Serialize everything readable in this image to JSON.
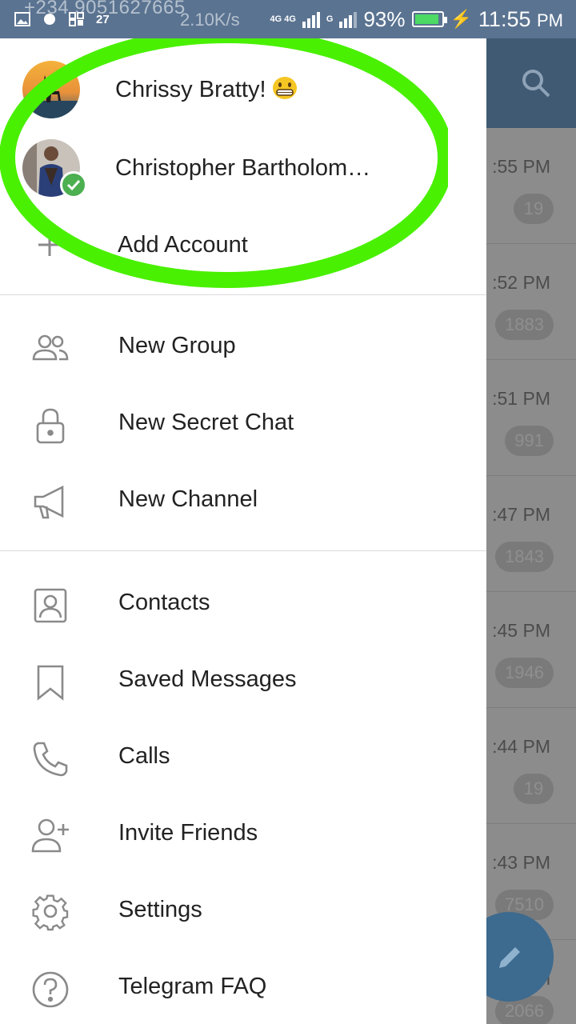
{
  "status_bar": {
    "overlay_number": "+234 9051627665",
    "badge": "27",
    "speed": "2.10K/s",
    "network_a": "4G 4G",
    "network_b": "G",
    "battery_percent": "93%",
    "time": "11:55",
    "ampm": "PM"
  },
  "accounts": [
    {
      "name": "Chrissy Bratty!",
      "emoji_icon": "grinning-face-emoji"
    },
    {
      "name": "Christopher Bartholom…",
      "verified": true
    }
  ],
  "add_account_label": "Add Account",
  "menu_group_1": [
    {
      "label": "New Group",
      "icon": "group-icon"
    },
    {
      "label": "New Secret Chat",
      "icon": "lock-icon"
    },
    {
      "label": "New Channel",
      "icon": "megaphone-icon"
    }
  ],
  "menu_group_2": [
    {
      "label": "Contacts",
      "icon": "contact-icon"
    },
    {
      "label": "Saved Messages",
      "icon": "bookmark-icon"
    },
    {
      "label": "Calls",
      "icon": "phone-icon"
    },
    {
      "label": "Invite Friends",
      "icon": "add-person-icon"
    },
    {
      "label": "Settings",
      "icon": "gear-icon"
    },
    {
      "label": "Telegram FAQ",
      "icon": "help-icon"
    }
  ],
  "background_chats": [
    {
      "time": ":55 PM",
      "count": "19"
    },
    {
      "time": ":52 PM",
      "count": "1883"
    },
    {
      "time": ":51 PM",
      "count": "991"
    },
    {
      "time": ":47 PM",
      "count": "1843"
    },
    {
      "time": ":45 PM",
      "count": "1946"
    },
    {
      "time": ":44 PM",
      "count": "19"
    },
    {
      "time": ":43 PM",
      "count": "7510"
    },
    {
      "time": "l",
      "count": "2066"
    }
  ],
  "colors": {
    "status_bar": "#5a7391",
    "header": "#405a73",
    "highlight": "#49f001",
    "verified": "#4caf50",
    "fab": "#3d6a8f"
  }
}
